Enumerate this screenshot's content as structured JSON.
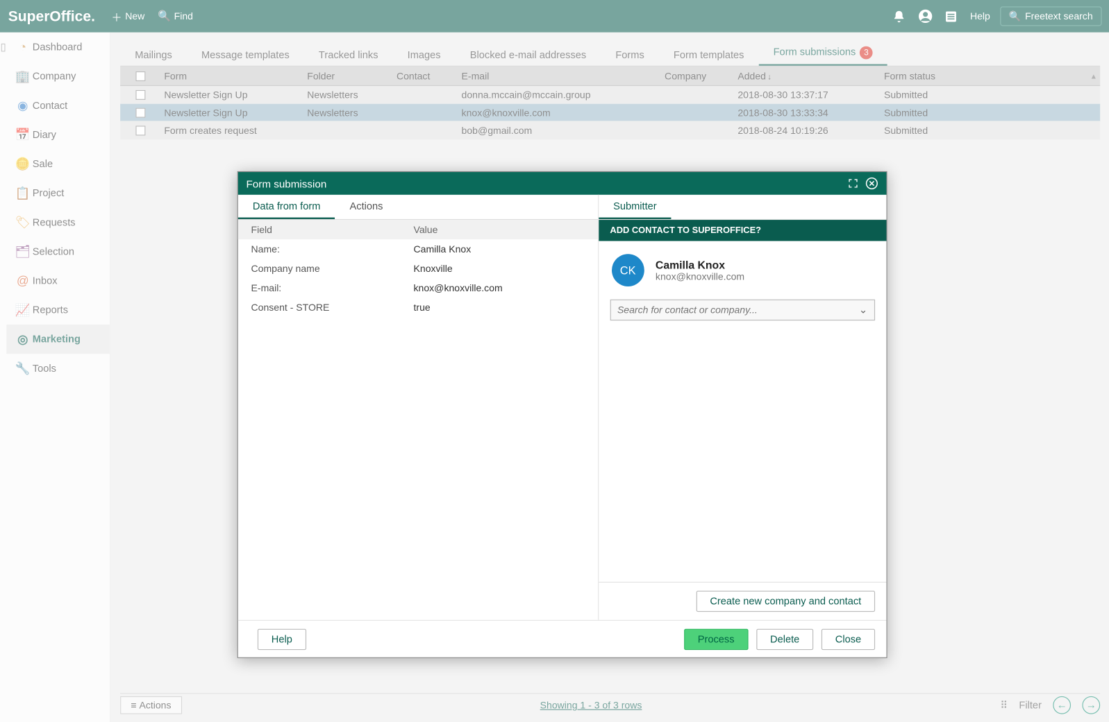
{
  "brand": "SuperOffice.",
  "top": {
    "new": "New",
    "find": "Find",
    "help": "Help",
    "freetext": "Freetext search"
  },
  "sidebar": {
    "items": [
      {
        "label": "Dashboard",
        "icon": "◔",
        "color": "#c95"
      },
      {
        "label": "Company",
        "icon": "🏢",
        "color": "#0a7"
      },
      {
        "label": "Contact",
        "icon": "◉",
        "color": "#2a79c7"
      },
      {
        "label": "Diary",
        "icon": "📅",
        "color": "#c44"
      },
      {
        "label": "Sale",
        "icon": "🪙",
        "color": "#caa22d"
      },
      {
        "label": "Project",
        "icon": "📋",
        "color": "#b24d4d"
      },
      {
        "label": "Requests",
        "icon": "🏷",
        "color": "#e6a33a"
      },
      {
        "label": "Selection",
        "icon": "🗂",
        "color": "#7d3c7d"
      },
      {
        "label": "Inbox",
        "icon": "@",
        "color": "#d9673a"
      },
      {
        "label": "Reports",
        "icon": "📈",
        "color": "#2a79c7"
      },
      {
        "label": "Marketing",
        "icon": "◎",
        "color": "#0a5c4f"
      },
      {
        "label": "Tools",
        "icon": "🔧",
        "color": "#555"
      }
    ],
    "active": 10
  },
  "tabs": [
    "Mailings",
    "Message templates",
    "Tracked links",
    "Images",
    "Blocked e-mail addresses",
    "Forms",
    "Form templates",
    "Form submissions"
  ],
  "tabs_badge": "3",
  "tabs_active": 7,
  "grid": {
    "headers": [
      "Form",
      "Folder",
      "Contact",
      "E-mail",
      "Company",
      "Added",
      "Form status"
    ],
    "sort_col": 5,
    "rows": [
      {
        "form": "Newsletter Sign Up",
        "folder": "Newsletters",
        "contact": "",
        "email": "donna.mccain@mccain.group",
        "company": "",
        "added": "2018-08-30 13:37:17",
        "status": "Submitted",
        "selected": false
      },
      {
        "form": "Newsletter Sign Up",
        "folder": "Newsletters",
        "contact": "",
        "email": "knox@knoxville.com",
        "company": "",
        "added": "2018-08-30 13:33:34",
        "status": "Submitted",
        "selected": true
      },
      {
        "form": "Form creates request",
        "folder": "",
        "contact": "",
        "email": "bob@gmail.com",
        "company": "",
        "added": "2018-08-24 10:19:26",
        "status": "Submitted",
        "selected": false
      }
    ]
  },
  "footer": {
    "actions": "Actions",
    "showing": "Showing 1 - 3 of 3 rows",
    "filter": "Filter"
  },
  "dialog": {
    "title": "Form submission",
    "left_tabs": [
      "Data from form",
      "Actions"
    ],
    "left_active": 0,
    "field_header": "Field",
    "value_header": "Value",
    "fields": [
      {
        "f": "Name:",
        "v": "Camilla Knox"
      },
      {
        "f": "Company name",
        "v": "Knoxville"
      },
      {
        "f": "E-mail:",
        "v": "knox@knoxville.com"
      },
      {
        "f": "Consent - STORE",
        "v": "true"
      }
    ],
    "right_tab": "Submitter",
    "right_banner": "ADD CONTACT TO SUPEROFFICE?",
    "avatar": "CK",
    "contact_name": "Camilla Knox",
    "contact_email": "knox@knoxville.com",
    "search_placeholder": "Search for contact or company...",
    "create_btn": "Create new company and contact",
    "help": "Help",
    "process": "Process",
    "delete": "Delete",
    "close": "Close"
  }
}
